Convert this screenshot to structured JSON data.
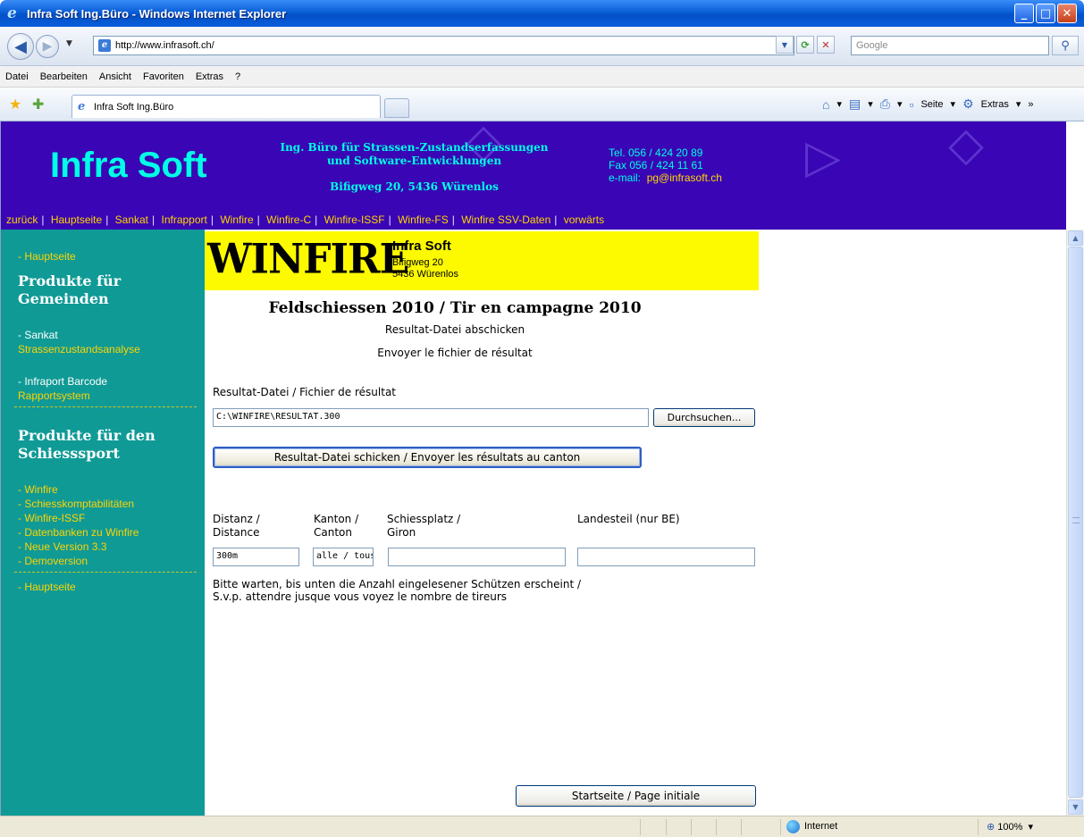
{
  "window": {
    "title": "Infra Soft Ing.Büro - Windows Internet Explorer"
  },
  "address": {
    "url": "http://www.infrasoft.ch/",
    "search_placeholder": "Google"
  },
  "menu": [
    "Datei",
    "Bearbeiten",
    "Ansicht",
    "Favoriten",
    "Extras",
    "?"
  ],
  "tab": {
    "title": "Infra Soft Ing.Büro"
  },
  "commandbar": {
    "page": "Seite",
    "tools": "Extras"
  },
  "header": {
    "brand": "Infra Soft",
    "tagline_1": "Ing. Büro für Strassen-Zustandserfassungen",
    "tagline_2": "und Software-Entwicklungen",
    "address": "Bifigweg 20, 5436 Würenlos",
    "tel": "Tel. 056 / 424 20 89",
    "fax": "Fax 056 / 424 11 61",
    "email_label": "e-mail:",
    "email": "pg@infrasoft.ch",
    "nav": [
      "zurück",
      "Hauptseite",
      "Sankat",
      "Infrapport",
      "Winfire",
      "Winfire-C",
      "Winfire-ISSF",
      "Winfire-FS",
      "Winfire SSV-Daten",
      "vorwärts"
    ]
  },
  "sidebar": {
    "home_top": "- Hauptseite",
    "heading_1": "Produkte für Gemeinden",
    "sankat": "- Sankat",
    "sankat_sub": "Strassenzustandsanalyse",
    "infraport": "- Infraport Barcode",
    "infraport_sub": "Rapportsystem",
    "heading_2": "Produkte für den Schiesssport",
    "items": [
      "- Winfire",
      "- Schiesskomptabilitäten",
      "- Winfire-ISSF",
      "- Datenbanken zu Winfire",
      "- Neue Version 3.3",
      "- Demoversion"
    ],
    "home_bottom": "- Hauptseite"
  },
  "content": {
    "logo": "WINFIRE",
    "company": "Infra Soft",
    "street": "Bifigweg 20",
    "city": "5436 Würenlos",
    "heading": "Feldschiessen 2010 / Tir en campagne 2010",
    "subtitle_de": "Resultat-Datei abschicken",
    "subtitle_fr": "Envoyer le fichier de résultat",
    "file_label": "Resultat-Datei / Fichier de résultat",
    "file_value": "C:\\WINFIRE\\RESULTAT.300",
    "browse": "Durchsuchen...",
    "send": "Resultat-Datei schicken / Envoyer les résultats au canton",
    "distanz_label_1": "Distanz /",
    "distanz_label_2": "Distance",
    "kanton_label_1": "Kanton /",
    "kanton_label_2": "Canton",
    "platz_label_1": "Schiessplatz /",
    "platz_label_2": "Giron",
    "landesteil_label": "Landesteil (nur BE)",
    "distanz_value": "300m",
    "kanton_value": "alle / tous",
    "note_1": "Bitte warten, bis unten die Anzahl eingelesener Schützen erscheint /",
    "note_2": "S.v.p. attendre jusque vous voyez le nombre de tireurs",
    "home_button": "Startseite / Page initiale"
  },
  "status": {
    "zone": "Internet",
    "zoom": "100%"
  }
}
